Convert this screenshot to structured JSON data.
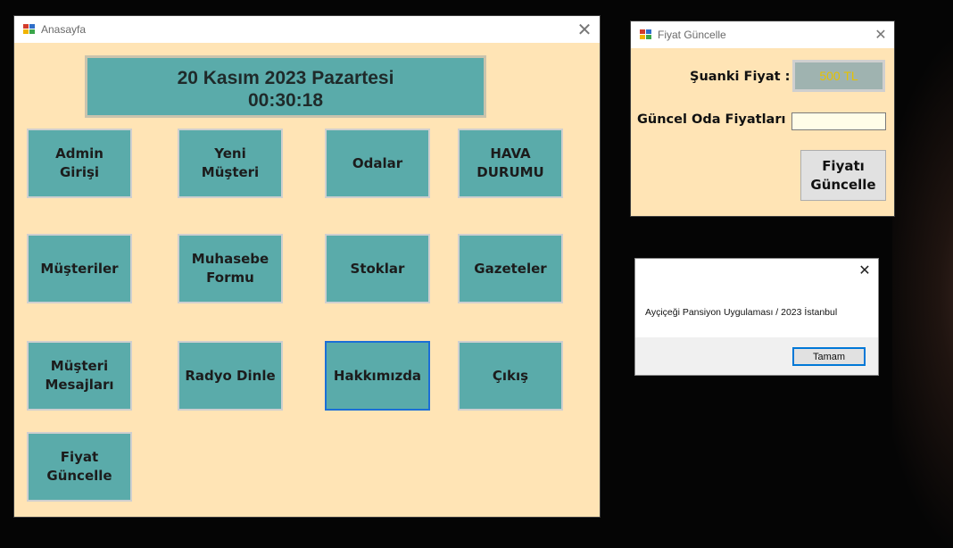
{
  "main_window": {
    "title": "Anasayfa",
    "close_glyph": "✕",
    "date_line": "20 Kasım 2023 Pazartesi",
    "time_line": "00:30:18",
    "buttons": [
      "Admin Girişi",
      "Yeni Müşteri",
      "Odalar",
      "HAVA DURUMU",
      "Müşteriler",
      "Muhasebe Formu",
      "Stoklar",
      "Gazeteler",
      "Müşteri Mesajları",
      "Radyo Dinle",
      "Hakkımızda",
      "Çıkış",
      "Fiyat Güncelle"
    ]
  },
  "price_window": {
    "title": "Fiyat Güncelle",
    "close_glyph": "✕",
    "current_price_label": "Şuanki Fiyat :",
    "current_price_value": "500 TL",
    "new_price_label": "Güncel Oda Fiyatları :",
    "new_price_value": "",
    "update_button": "Fiyatı Güncelle"
  },
  "message_box": {
    "close_glyph": "✕",
    "message": "Ayçiçeği Pansiyon Uygulaması / 2023 İstanbul",
    "ok_button": "Tamam"
  },
  "icons": {
    "window_icon": "app-window-icon",
    "close": "close-icon"
  },
  "colors": {
    "form_background": "#ffe4b5",
    "tile": "#5aabaa",
    "price_text": "#e6c200",
    "focus_border": "#1c6fd6"
  }
}
